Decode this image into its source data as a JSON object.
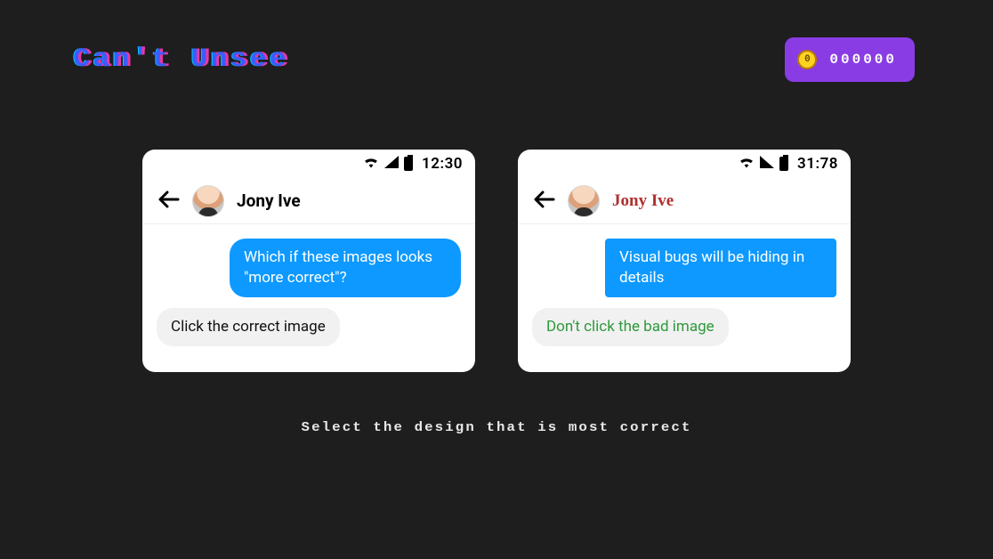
{
  "logo_text": "Can't Unsee",
  "score": "000000",
  "instruction": "Select the design that is most correct",
  "left": {
    "time": "12:30",
    "contact": "Jony Ive",
    "sent": "Which if these images looks \"more correct\"?",
    "recv": "Click the correct image"
  },
  "right": {
    "time": "31:78",
    "contact": "Jony Ive",
    "sent": "Visual bugs will be hiding in details",
    "recv": "Don't click the bad image"
  }
}
